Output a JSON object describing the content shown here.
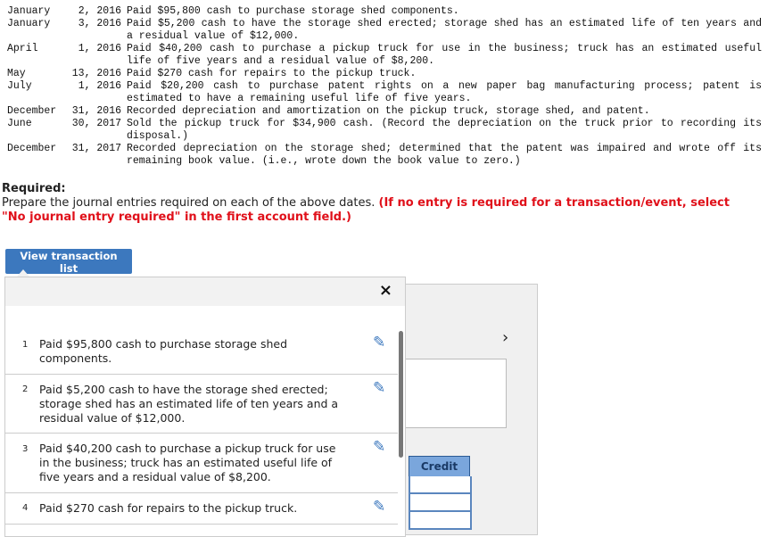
{
  "transactions": [
    {
      "month": "January",
      "day": "2, 2016",
      "text": "Paid $95,800 cash to purchase storage shed components."
    },
    {
      "month": "January",
      "day": "3, 2016",
      "text": "Paid $5,200 cash to have the storage shed erected; storage shed has an estimated life of ten years and a residual value of $12,000."
    },
    {
      "month": "April",
      "day": "1, 2016",
      "text": "Paid $40,200 cash to purchase a pickup truck for use in the business; truck has an estimated useful life of five years and a residual value of $8,200."
    },
    {
      "month": "May",
      "day": "13, 2016",
      "text": "Paid $270 cash for repairs to the pickup truck."
    },
    {
      "month": "July",
      "day": "1, 2016",
      "text": "Paid $20,200 cash to purchase patent rights on a new paper bag manufacturing process; patent is estimated to have a remaining useful life of five years."
    },
    {
      "month": "December",
      "day": "31, 2016",
      "text": "Recorded depreciation and amortization on the pickup truck, storage shed, and patent."
    },
    {
      "month": "June",
      "day": "30, 2017",
      "text": "Sold the pickup truck for $34,900 cash. (Record the depreciation on the truck prior to recording its disposal.)"
    },
    {
      "month": "December",
      "day": "31, 2017",
      "text": "Recorded depreciation on the storage shed; determined that the patent was impaired and wrote off its remaining book value. (i.e., wrote down the book value to zero.)"
    }
  ],
  "required": {
    "label": "Required:",
    "text": "Prepare the journal entries required on each of the above dates. ",
    "note": "(If no entry is required for a transaction/event, select \"No journal entry required\" in the first account field.)"
  },
  "view_button": "View transaction list",
  "close_icon": "×",
  "chevron": "›",
  "credit_header": "Credit",
  "list": [
    {
      "num": "1",
      "text": "Paid $95,800 cash to purchase storage shed components."
    },
    {
      "num": "2",
      "text": "Paid $5,200 cash to have the storage shed erected; storage shed has an estimated life of ten years and a residual value of $12,000."
    },
    {
      "num": "3",
      "text": "Paid $40,200 cash to purchase a pickup truck for use in the business; truck has an estimated useful life of five years and a residual value of $8,200."
    },
    {
      "num": "4",
      "text": "Paid $270 cash for repairs to the pickup truck."
    }
  ],
  "colors": {
    "accent": "#3c78be",
    "required_note": "#e0101a",
    "credit_header": "#7aa6dc"
  }
}
